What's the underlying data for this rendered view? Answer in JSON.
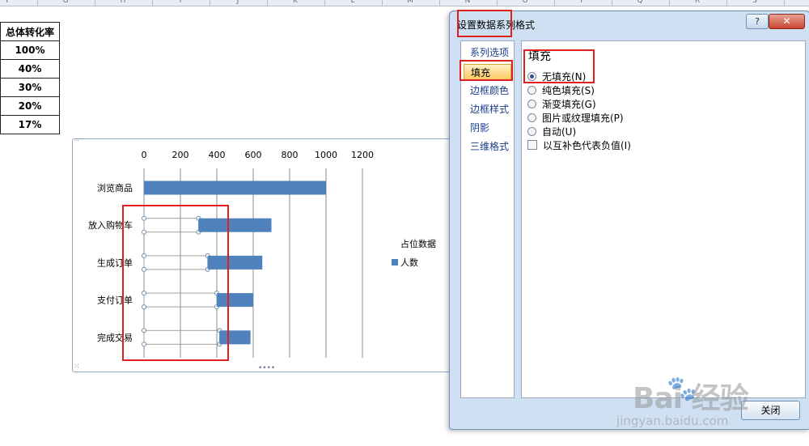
{
  "sheet": {
    "column_letters": [
      "F",
      "G",
      "H",
      "I",
      "J",
      "K",
      "L",
      "M",
      "N",
      "O",
      "P",
      "Q",
      "R",
      "S"
    ],
    "table": {
      "header": "总体转化率",
      "values": [
        "100%",
        "40%",
        "30%",
        "20%",
        "17%"
      ]
    }
  },
  "chart_data": {
    "type": "bar",
    "orientation": "horizontal",
    "stacked": true,
    "categories": [
      "浏览商品",
      "放入购物车",
      "生成订单",
      "支付订单",
      "完成交易"
    ],
    "x_ticks": [
      "0",
      "200",
      "400",
      "600",
      "800",
      "1000",
      "1200"
    ],
    "xlim": [
      0,
      1200
    ],
    "grid": true,
    "series": [
      {
        "name": "占位数据",
        "values": [
          0,
          300,
          350,
          400,
          415
        ],
        "fill": "none"
      },
      {
        "name": "人数",
        "values": [
          1000,
          400,
          300,
          200,
          170
        ],
        "color": "#4f81bd"
      }
    ],
    "legend": {
      "placement": "right",
      "entries": [
        "占位数据",
        "人数"
      ]
    }
  },
  "dialog": {
    "title": "设置数据系列格式",
    "help_label": "?",
    "close_x_label": "✕",
    "nav_items": [
      "系列选项",
      "填充",
      "边框颜色",
      "边框样式",
      "阴影",
      "三维格式"
    ],
    "active_nav": "填充",
    "section_heading": "填充",
    "options": [
      {
        "label": "无填充(N)",
        "kind": "radio",
        "checked": true
      },
      {
        "label": "纯色填充(S)",
        "kind": "radio",
        "checked": false
      },
      {
        "label": "渐变填充(G)",
        "kind": "radio",
        "checked": false
      },
      {
        "label": "图片或纹理填充(P)",
        "kind": "radio",
        "checked": false
      },
      {
        "label": "自动(U)",
        "kind": "radio",
        "checked": false
      },
      {
        "label": "以互补色代表负值(I)",
        "kind": "checkbox",
        "checked": false
      }
    ],
    "close_button_label": "关闭"
  },
  "watermark": {
    "logo": "Bai  经验",
    "url": "jingyan.baidu.com"
  },
  "colors": {
    "series_blue": "#4f81bd",
    "highlight_red": "#e02020",
    "dialog_bg": "#cfe0f3"
  }
}
